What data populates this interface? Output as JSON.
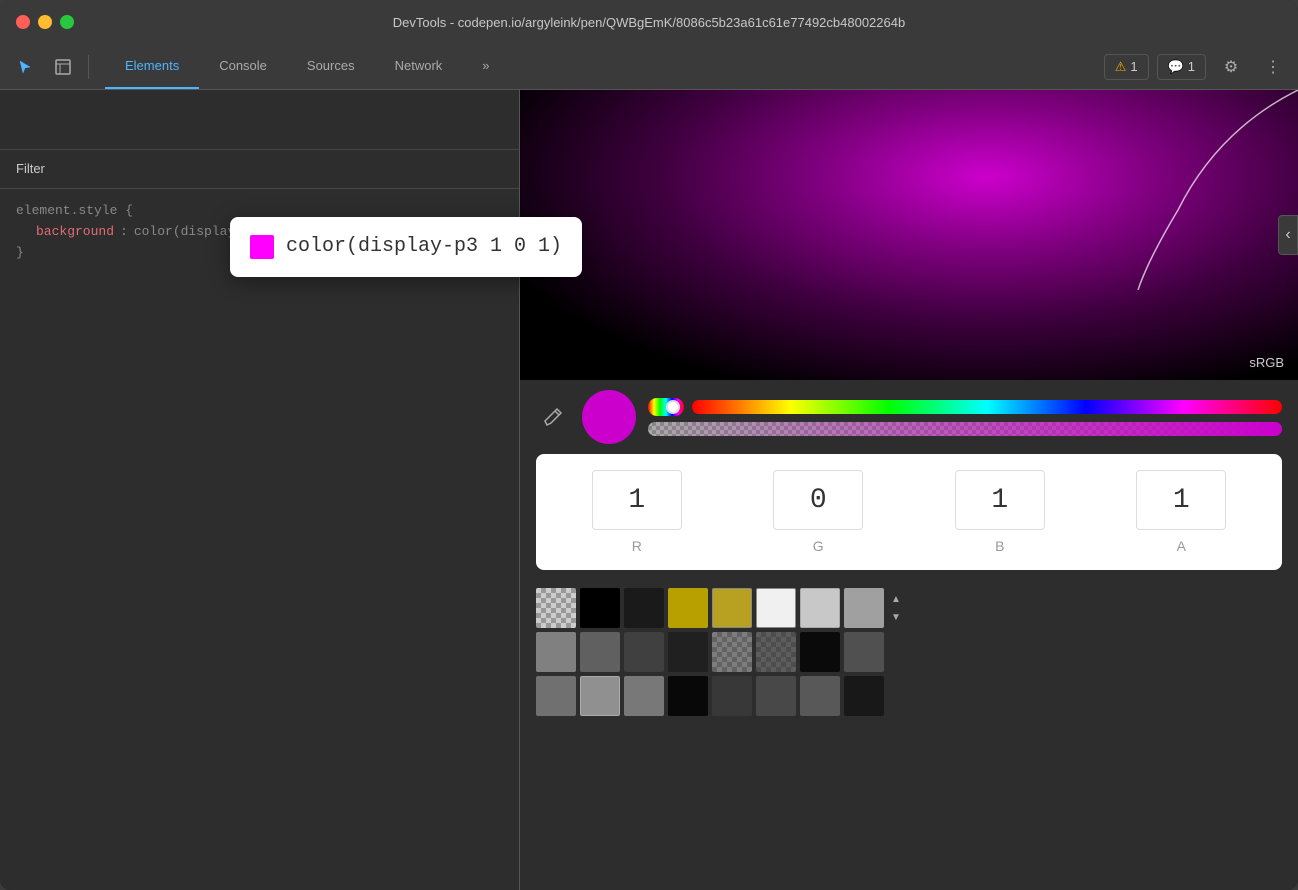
{
  "window": {
    "title": "DevTools - codepen.io/argyleink/pen/QWBgEmK/8086c5b23a61c61e77492cb48002264b"
  },
  "toolbar": {
    "tabs": [
      {
        "id": "elements",
        "label": "Elements",
        "active": true
      },
      {
        "id": "console",
        "label": "Console",
        "active": false
      },
      {
        "id": "sources",
        "label": "Sources",
        "active": false
      },
      {
        "id": "network",
        "label": "Network",
        "active": false
      }
    ],
    "more_label": "»",
    "warn_count": "1",
    "info_count": "1",
    "settings_icon": "⚙",
    "more_icon": "⋮"
  },
  "left_panel": {
    "filter_placeholder": "Filter",
    "filter_value": "Filter",
    "code_line1": "element.style {",
    "code_property": "background",
    "code_value": "color(display-p3 1 0 1);",
    "code_closing": "}"
  },
  "tooltip": {
    "text": "color(display-p3 1 0 1)",
    "color": "#ff00ff"
  },
  "color_picker": {
    "srgb_label": "sRGB",
    "channels": [
      {
        "id": "r",
        "label": "R",
        "value": "1"
      },
      {
        "id": "g",
        "label": "G",
        "value": "0"
      },
      {
        "id": "b",
        "label": "B",
        "value": "1"
      },
      {
        "id": "a",
        "label": "A",
        "value": "1"
      }
    ],
    "swatches_row1": [
      {
        "color": "checkered",
        "id": "transparent"
      },
      {
        "color": "#000000"
      },
      {
        "color": "#1a1a1a"
      },
      {
        "color": "#b8a000"
      },
      {
        "color": "#b8a020"
      },
      {
        "color": "#f0f0f0"
      },
      {
        "color": "#c8c8c8"
      },
      {
        "color": "#a0a0a0"
      }
    ],
    "swatches_row2": [
      {
        "color": "#808080"
      },
      {
        "color": "#606060"
      },
      {
        "color": "#404040"
      },
      {
        "color": "#202020"
      },
      {
        "color": "checker2"
      },
      {
        "color": "checker3"
      },
      {
        "color": "#0a0a0a"
      },
      {
        "color": "#505050"
      }
    ],
    "swatches_row3": [
      {
        "color": "#707070"
      },
      {
        "color": "#909090"
      },
      {
        "color": "#787878"
      },
      {
        "color": "#080808"
      },
      {
        "color": "#383838"
      },
      {
        "color": "#484848"
      },
      {
        "color": "#585858"
      },
      {
        "color": "#181818"
      }
    ]
  }
}
